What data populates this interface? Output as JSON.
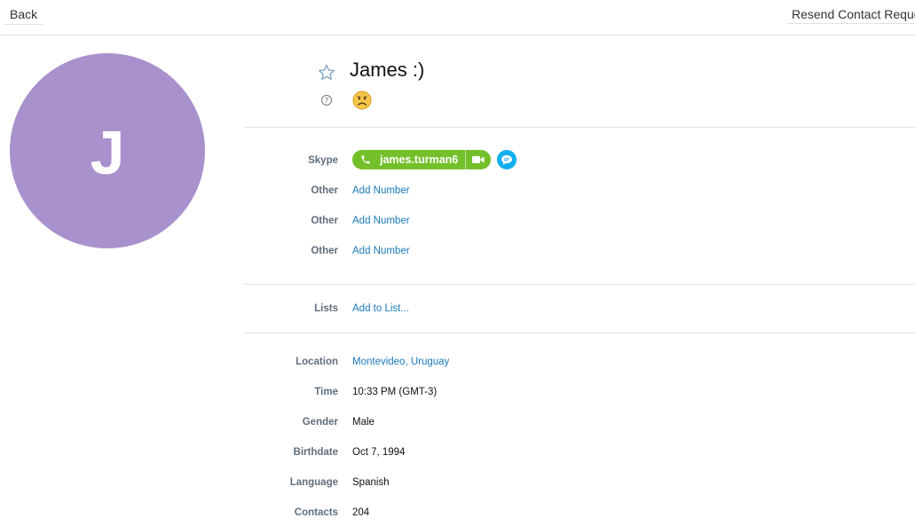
{
  "topbar": {
    "back_label": "Back",
    "resend_label": "Resend Contact Request"
  },
  "profile": {
    "avatar_initial": "J",
    "avatar_color": "#a991cd",
    "display_name": "James :)",
    "mood_icon": "sad-face-emoji"
  },
  "contact": {
    "skype_label": "Skype",
    "skype_name": "james.turman6",
    "skype_pill_color": "#73c02a",
    "chat_button_color": "#12aff0",
    "phones": [
      {
        "label": "Other",
        "action": "Add Number"
      },
      {
        "label": "Other",
        "action": "Add Number"
      },
      {
        "label": "Other",
        "action": "Add Number"
      }
    ]
  },
  "lists": {
    "label": "Lists",
    "action": "Add to List..."
  },
  "details": {
    "location": {
      "label": "Location",
      "value": "Montevideo, Uruguay"
    },
    "time": {
      "label": "Time",
      "value": "10:33 PM (GMT-3)"
    },
    "gender": {
      "label": "Gender",
      "value": "Male"
    },
    "birthdate": {
      "label": "Birthdate",
      "value": "Oct 7, 1994"
    },
    "language": {
      "label": "Language",
      "value": "Spanish"
    },
    "contacts": {
      "label": "Contacts",
      "value": "204"
    }
  },
  "link_color": "#1a7ab8"
}
